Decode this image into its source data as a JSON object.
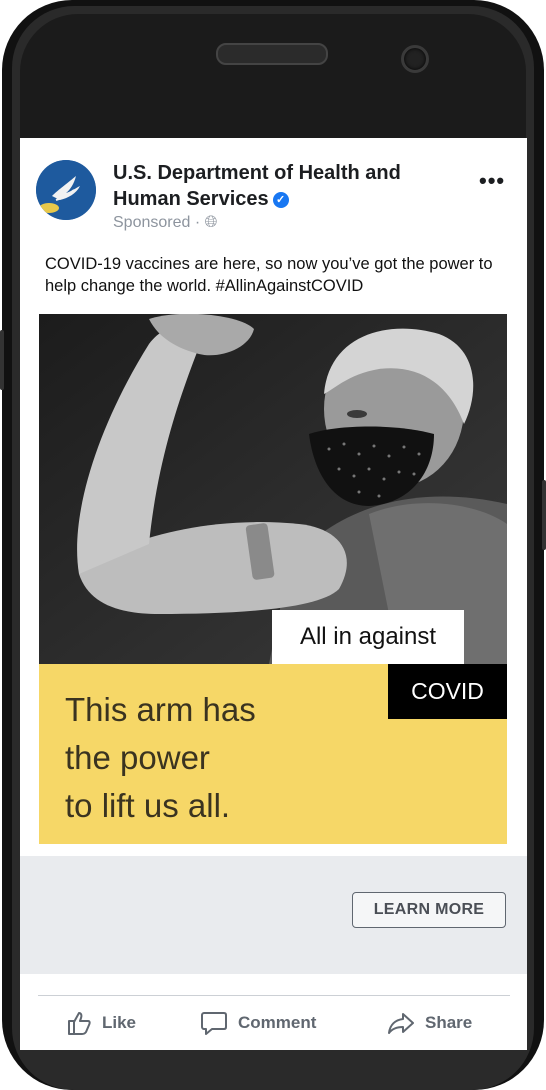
{
  "post": {
    "page_name": "U.S. Department of Health and Human Services",
    "sponsored_label": "Sponsored · ",
    "avatar_text": "HHS",
    "caption": "COVID-19 vaccines are here, so now you’ve got the power to help change the world. #AllinAgainstCOVID"
  },
  "ad": {
    "tag_white": "All in against",
    "tag_black": "COVID",
    "headline_lines": [
      "This arm has",
      "the power",
      "to lift us all."
    ],
    "cta_label": "LEARN MORE"
  },
  "actions": {
    "like": "Like",
    "comment": "Comment",
    "share": "Share"
  },
  "colors": {
    "ad_yellow": "#f6d767",
    "verified_blue": "#1877f2",
    "hhs_blue": "#1e5a9e"
  }
}
